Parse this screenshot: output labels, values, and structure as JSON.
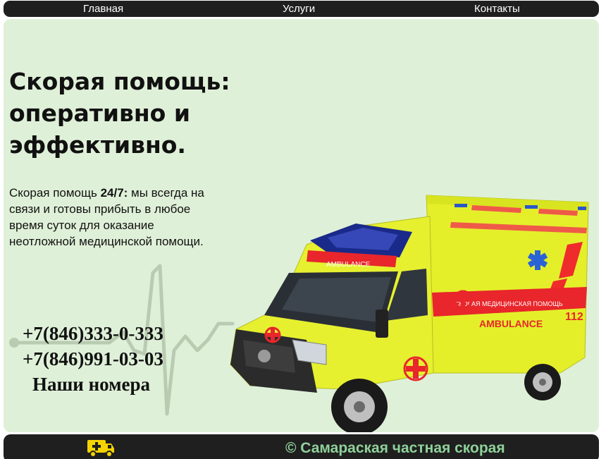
{
  "nav": {
    "home": "Главная",
    "services": "Услуги",
    "contacts": "Контакты"
  },
  "hero": {
    "headline_line1": "Скорая помощь:",
    "headline_line2": "оперативно и",
    "headline_line3": "эффективно.",
    "lead_prefix": "Скорая помощь ",
    "lead_emphasis": "24/7:",
    "lead_rest": " мы всегда на связи и готовы прибыть в любое время суток для оказание неотложной медицинской помощи.",
    "phone_1": "+7(846)333-0-333",
    "phone_2": "+7(846)991-03-03",
    "phones_caption": "Наши номера"
  },
  "ambulance": {
    "hood_text": "AMBULANCE",
    "side_text": "СКОРАЯ   МЕДИЦИНСКАЯ   ПОМОЩЬ",
    "side_brand": "AMBULANCE",
    "side_number": "112"
  },
  "footer": {
    "text": "© Самараская частная скорая",
    "icon": "ambulance-icon"
  },
  "colors": {
    "bar": "#1f1f1f",
    "hero_bg": "#dff0d8",
    "footer_text": "#8fd19a",
    "van_yellow": "#e4ef2a",
    "van_red": "#e8262b"
  }
}
